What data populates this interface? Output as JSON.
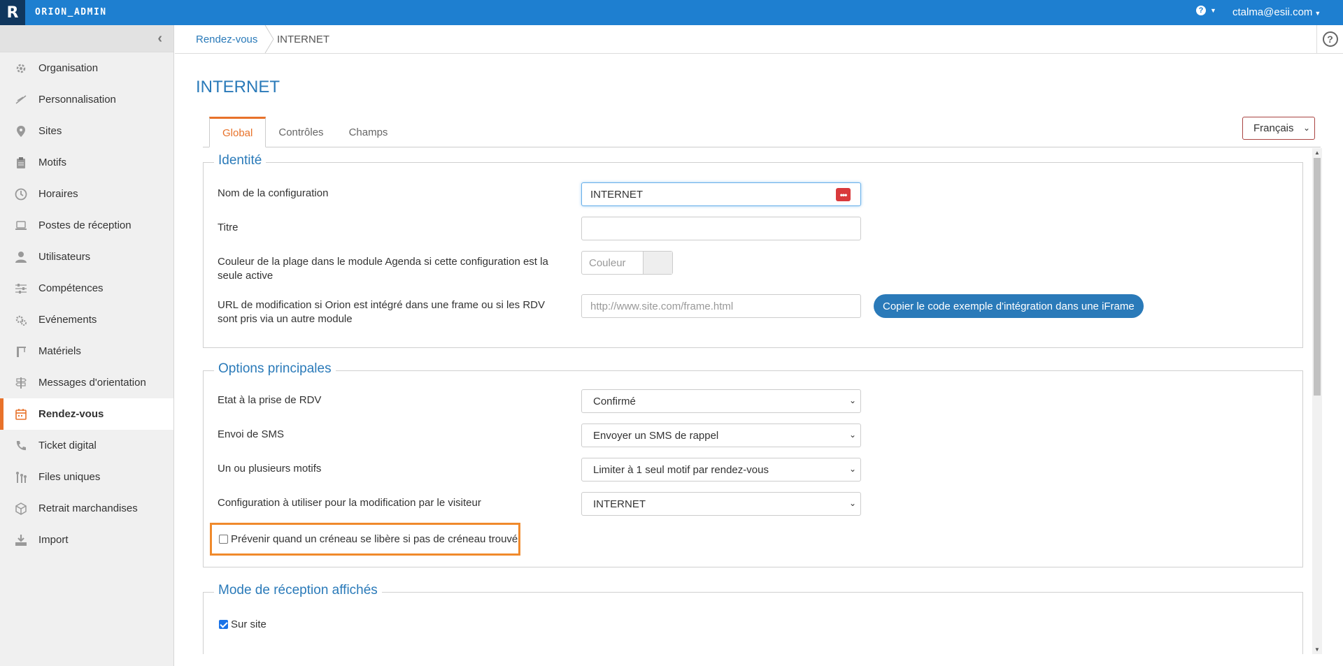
{
  "app": {
    "logo_letter": "R",
    "title": "ORION_ADMIN",
    "help_symbol": "?",
    "user_email": "ctalma@esii.com"
  },
  "sidebar": {
    "items": [
      {
        "label": "Organisation",
        "icon": "gear-icon"
      },
      {
        "label": "Personnalisation",
        "icon": "brush-icon"
      },
      {
        "label": "Sites",
        "icon": "map-pin-icon"
      },
      {
        "label": "Motifs",
        "icon": "clipboard-icon"
      },
      {
        "label": "Horaires",
        "icon": "clock-icon"
      },
      {
        "label": "Postes de réception",
        "icon": "laptop-icon"
      },
      {
        "label": "Utilisateurs",
        "icon": "user-icon"
      },
      {
        "label": "Compétences",
        "icon": "sliders-icon"
      },
      {
        "label": "Evénements",
        "icon": "gears-icon"
      },
      {
        "label": "Matériels",
        "icon": "crane-icon"
      },
      {
        "label": "Messages d'orientation",
        "icon": "signpost-icon"
      },
      {
        "label": "Rendez-vous",
        "icon": "calendar-icon",
        "active": true
      },
      {
        "label": "Ticket digital",
        "icon": "phone-icon"
      },
      {
        "label": "Files uniques",
        "icon": "queue-icon"
      },
      {
        "label": "Retrait marchandises",
        "icon": "box-icon"
      },
      {
        "label": "Import",
        "icon": "download-icon"
      }
    ]
  },
  "breadcrumb": {
    "parent": "Rendez-vous",
    "current": "INTERNET"
  },
  "page": {
    "title": "INTERNET",
    "language": "Français",
    "tabs": [
      {
        "label": "Global",
        "active": true
      },
      {
        "label": "Contrôles"
      },
      {
        "label": "Champs"
      }
    ]
  },
  "identite": {
    "legend": "Identité",
    "config_name_label": "Nom de la configuration",
    "config_name_value": "INTERNET",
    "titre_label": "Titre",
    "titre_value": "",
    "couleur_label": "Couleur de la plage dans le module Agenda si cette configuration est la seule active",
    "couleur_placeholder": "Couleur",
    "url_label": "URL de modification si Orion est intégré dans une frame ou si les RDV sont pris via un autre module",
    "url_placeholder": "http://www.site.com/frame.html",
    "copy_button": "Copier le code exemple d'intégration dans une iFrame"
  },
  "options": {
    "legend": "Options principales",
    "etat_label": "Etat à la prise de RDV",
    "etat_value": "Confirmé",
    "sms_label": "Envoi de SMS",
    "sms_value": "Envoyer un SMS de rappel",
    "motifs_label": "Un ou plusieurs motifs",
    "motifs_value": "Limiter à 1 seul motif par rendez-vous",
    "config_modif_label": "Configuration à utiliser pour la modification par le visiteur",
    "config_modif_value": "INTERNET",
    "prevenir_label": "Prévenir quand un créneau se libère si pas de créneau trouvé",
    "prevenir_checked": false
  },
  "reception": {
    "legend": "Mode de réception affichés",
    "sur_site_label": "Sur site",
    "sur_site_checked": true
  },
  "colors": {
    "topbar": "#1e7fd0",
    "accent": "#e8722a",
    "link": "#2a7ab9",
    "highlight": "#f08a2c"
  }
}
